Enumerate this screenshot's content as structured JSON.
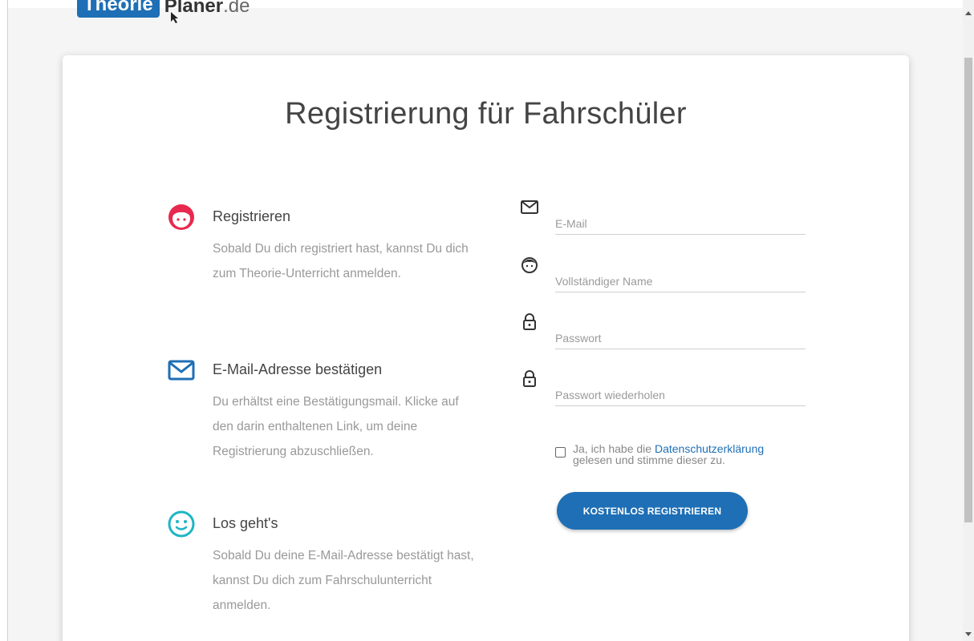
{
  "header": {
    "logo_brand": "Theorie",
    "logo_name": "Planer",
    "logo_tld": ".de"
  },
  "page": {
    "title": "Registrierung für Fahrschüler"
  },
  "steps": [
    {
      "icon": "face-icon",
      "heading": "Registrieren",
      "description": "Sobald Du dich registriert hast, kannst Du dich zum Theorie-Unterricht anmelden."
    },
    {
      "icon": "envelope-icon",
      "heading": "E-Mail-Adresse bestätigen",
      "description": "Du erhältst eine Bestätigungsmail. Klicke auf den darin enthaltenen Link, um deine Registrierung abzuschließen."
    },
    {
      "icon": "smiley-icon",
      "heading": "Los geht's",
      "description": "Sobald Du deine E-Mail-Adresse bestätigt hast, kannst Du dich zum Fahrschulunterricht anmelden."
    }
  ],
  "form": {
    "email": {
      "placeholder": "E-Mail",
      "value": ""
    },
    "name": {
      "placeholder": "Vollständiger Name",
      "value": ""
    },
    "password": {
      "placeholder": "Passwort",
      "value": ""
    },
    "password_repeat": {
      "placeholder": "Passwort wiederholen",
      "value": ""
    },
    "consent": {
      "prefix": "Ja, ich habe die ",
      "link": "Datenschutzerklärung",
      "suffix": "gelesen und stimme dieser zu.",
      "checked": false
    },
    "submit_label": "KOSTENLOS REGISTRIEREN"
  },
  "colors": {
    "accent": "#1e6fb5",
    "step1_icon": "#e8294f",
    "step2_icon": "#1e6fb5",
    "step3_icon": "#1fb5c4"
  }
}
